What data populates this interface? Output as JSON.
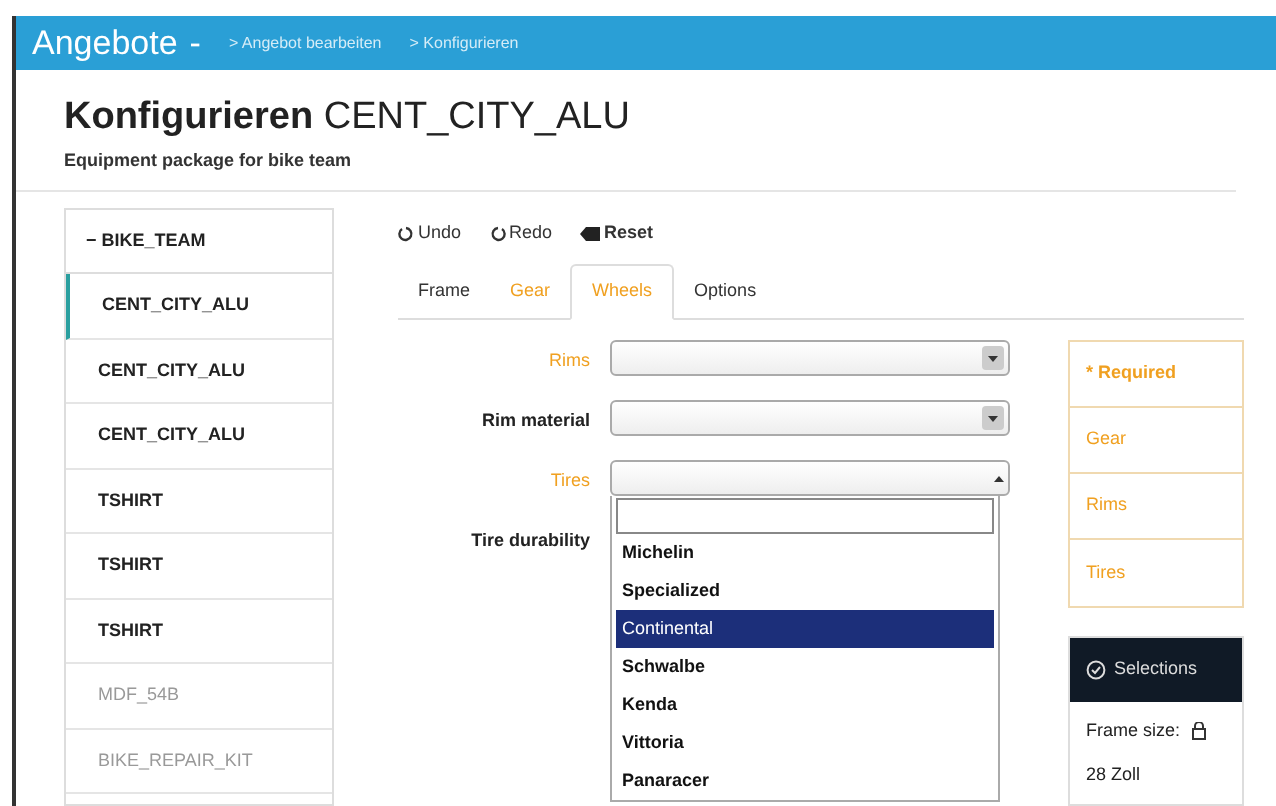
{
  "header": {
    "app_menu": "Angebote",
    "menu_caret": "-",
    "breadcrumbs": [
      "> Angebot bearbeiten",
      "> Konfigurieren"
    ]
  },
  "page": {
    "title_prefix": "Konfigurieren",
    "title_name": "CENT_CITY_ALU",
    "subtitle": "Equipment package for bike team"
  },
  "tree": {
    "root": {
      "toggle": "−",
      "label": "BIKE_TEAM",
      "expanded": true,
      "children": [
        {
          "label": "CENT_CITY_ALU",
          "selected": true,
          "disabled": false
        },
        {
          "label": "CENT_CITY_ALU",
          "selected": false,
          "disabled": false
        },
        {
          "label": "CENT_CITY_ALU",
          "selected": false,
          "disabled": false
        },
        {
          "label": "TSHIRT",
          "selected": false,
          "disabled": false
        },
        {
          "label": "TSHIRT",
          "selected": false,
          "disabled": false
        },
        {
          "label": "TSHIRT",
          "selected": false,
          "disabled": false
        },
        {
          "label": "MDF_54B",
          "selected": false,
          "disabled": true
        },
        {
          "label": "BIKE_REPAIR_KIT",
          "selected": false,
          "disabled": true
        }
      ]
    }
  },
  "toolbar": [
    {
      "kind": "undo",
      "label": "Undo"
    },
    {
      "kind": "redo",
      "label": "Redo"
    },
    {
      "kind": "reset",
      "label": "Reset"
    }
  ],
  "tabs": [
    {
      "label": "Frame",
      "selected": false,
      "required": false
    },
    {
      "label": "Gear",
      "selected": false,
      "required": true
    },
    {
      "label": "Wheels",
      "selected": true,
      "required": true
    },
    {
      "label": "Options",
      "selected": false,
      "required": false
    }
  ],
  "fields": [
    {
      "label": "Rims",
      "required": true,
      "kind": "select"
    },
    {
      "label": "Rim material",
      "required": false,
      "kind": "select"
    },
    {
      "label": "Tires",
      "required": true,
      "kind": "select",
      "dropdown": {
        "options": [
          {
            "label": "Michelin",
            "selected": false
          },
          {
            "label": "Specialized",
            "selected": false
          },
          {
            "label": "Continental",
            "selected": true
          },
          {
            "label": "Schwalbe",
            "selected": false
          },
          {
            "label": "Kenda",
            "selected": false
          },
          {
            "label": "Vittoria",
            "selected": false
          },
          {
            "label": "Panaracer",
            "selected": false
          }
        ]
      }
    },
    {
      "label": "Tire durability",
      "required": false,
      "kind": "covered"
    }
  ],
  "required_panel": {
    "heading": "* Required",
    "items": [
      "Gear",
      "Rims",
      "Tires"
    ]
  },
  "selections": {
    "heading": "Selections",
    "label": "Frame size:",
    "value": "28 Zoll"
  }
}
